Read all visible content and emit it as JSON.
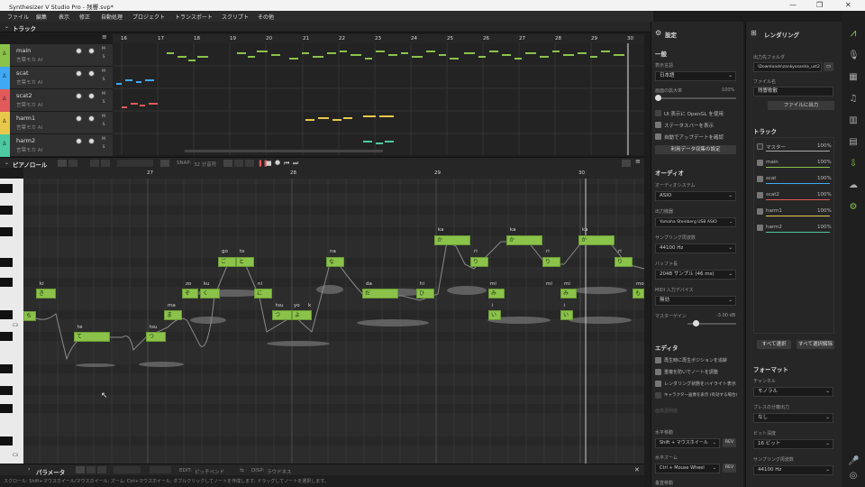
{
  "window": {
    "title": "Synthesizer V Studio Pro - 残響.svp*",
    "min": "—",
    "max": "❐",
    "close": "✕"
  },
  "menu": [
    "ファイル",
    "編集",
    "表示",
    "修正",
    "自動処理",
    "プロジェクト",
    "トランスポート",
    "スクリプト",
    "その他"
  ],
  "tracks_header": {
    "title": "トラック",
    "menu_icon": "hamburger-icon"
  },
  "tracks": [
    {
      "name": "main",
      "voice": "言葉モカ AI",
      "color": "#8bc34a"
    },
    {
      "name": "scat",
      "voice": "言葉モカ AI",
      "color": "#3fa9f5"
    },
    {
      "name": "scat2",
      "voice": "言葉モカ AI",
      "color": "#e25a5a"
    },
    {
      "name": "harm1",
      "voice": "言葉モカ AI",
      "color": "#e8c84a"
    },
    {
      "name": "harm2",
      "voice": "言葉モカ AI",
      "color": "#4cc9a0"
    }
  ],
  "track_ms": {
    "m": "M",
    "s": "S"
  },
  "arrangement_ruler": [
    "16",
    "17",
    "18",
    "19",
    "20",
    "21",
    "22",
    "23",
    "24",
    "25",
    "26",
    "27",
    "28",
    "29",
    "30"
  ],
  "pianoroll": {
    "title": "ピアノロール",
    "snap_label": "SNAP:",
    "snap_value": "32 分音符",
    "ruler": [
      "27",
      "28",
      "29",
      "30"
    ],
    "c_label": "C3",
    "c_label2": "C3",
    "notes": [
      {
        "l": "ki",
        "t": "き"
      },
      {
        "l": "",
        "t": "ち"
      },
      {
        "l": "te",
        "t": "て"
      },
      {
        "l": "tsu",
        "t": "つ"
      },
      {
        "l": "ma",
        "t": "ま"
      },
      {
        "l": "zo",
        "t": "ぞ"
      },
      {
        "l": "ku",
        "t": "く"
      },
      {
        "l": "go",
        "t": "ご"
      },
      {
        "l": "to",
        "t": "と"
      },
      {
        "l": "ni",
        "t": "に"
      },
      {
        "l": "tsu",
        "t": "つ"
      },
      {
        "l": "yo",
        "t": "よ"
      },
      {
        "l": "k",
        "t": "く"
      },
      {
        "l": "na",
        "t": "な"
      },
      {
        "l": "da",
        "t": "だ"
      },
      {
        "l": "hi",
        "t": "ひ"
      },
      {
        "l": "ka",
        "t": "か"
      },
      {
        "l": "ri",
        "t": "り"
      },
      {
        "l": "mi",
        "t": "み"
      },
      {
        "l": "ka",
        "t": "か"
      },
      {
        "l": "ri",
        "t": "り"
      },
      {
        "l": "mi",
        "t": "み"
      },
      {
        "l": "ka",
        "t": "か"
      },
      {
        "l": "ri",
        "t": "り"
      },
      {
        "l": "mo",
        "t": "も"
      },
      {
        "l": "mi",
        "t": "み"
      },
      {
        "l": "i",
        "t": "い"
      },
      {
        "l": "i",
        "t": "い"
      }
    ]
  },
  "param_bar": {
    "title": "パラメータ",
    "edit_label": "EDIT:",
    "edit_value": "ピッチベンド",
    "disp_label": "DISP:",
    "disp_value": "ラウドネス"
  },
  "status": "スクロール: Shift+マウスホイール/マウスホイール; ズーム: Ctrl+マウスホイール; ダブルクリックしてノートを作成します; ドラッグしてノートを選択します。",
  "settings": {
    "title": "設定",
    "general": "一般",
    "lang_label": "表示言語",
    "lang_value": "日本語",
    "scale_label": "画面の拡大率",
    "scale_value": "100%",
    "checks": [
      {
        "text": "UI 表示に OpenGL を使用",
        "on": false
      },
      {
        "text": "ステータスバーを表示",
        "on": true
      },
      {
        "text": "自動でアップデートを確認",
        "on": true
      }
    ],
    "data_btn": "利用データ収集の設定",
    "audio": "オーディオ",
    "sys_label": "オーディオシステム",
    "sys_value": "ASIO",
    "dev_label": "出力機器",
    "dev_value": "Yamaha Steinberg USB ASIO",
    "sr_label": "サンプリング周波数",
    "sr_value": "44100 Hz",
    "buf_label": "バッファ長",
    "buf_value": "2048 サンプル (46 ms)",
    "midi_label": "MIDI 入力デバイス",
    "midi_value": "無効",
    "gain_label": "マスターゲイン",
    "gain_value": "-3.00 dB",
    "editor": "エディタ",
    "echecks": [
      {
        "text": "再生時に再生ポジションを追跡",
        "on": true
      },
      {
        "text": "重複を防いでノートを調整",
        "on": true
      },
      {
        "text": "レンダリング状態をハイライト表示",
        "on": true
      },
      {
        "text": "キャラクター画像を表示 (有効する場合)",
        "on": false
      }
    ],
    "transparency": "画像透明度",
    "hmove_label": "水平移動",
    "hmove_value": "Shift + マウスホイール",
    "rev1": "REV",
    "hzoom_label": "水平ズーム",
    "hzoom_value": "Ctrl + Mouse Wheel",
    "rev2": "REV",
    "vmove_label": "垂直移動"
  },
  "render": {
    "title": "レンダリング",
    "folder_label": "出力先フォルダ",
    "folder_value": "\\Downloads\\zankyosanka_ust2",
    "file_label": "ファイル名",
    "file_value": "残響歌散",
    "export_btn": "ファイルに出力",
    "tracks_title": "トラック",
    "tracks": [
      {
        "name": "マスター",
        "vol": "100%",
        "on": false,
        "color": "#aaaaaa"
      },
      {
        "name": "main",
        "vol": "100%",
        "on": true,
        "color": "#8bc34a"
      },
      {
        "name": "scat",
        "vol": "100%",
        "on": true,
        "color": "#3fa9f5"
      },
      {
        "name": "scat2",
        "vol": "100%",
        "on": true,
        "color": "#e25a5a"
      },
      {
        "name": "harm1",
        "vol": "100%",
        "on": true,
        "color": "#e8c84a"
      },
      {
        "name": "harm2",
        "vol": "100%",
        "on": true,
        "color": "#4cc9a0"
      }
    ],
    "select_all": "すべて選択",
    "deselect_all": "すべて選択解除",
    "format": "フォーマット",
    "ch_label": "チャンネル",
    "ch_value": "モノラル",
    "breath_label": "ブレスの分離出力",
    "breath_value": "なし",
    "bit_label": "ビット深度",
    "bit_value": "16 ビット",
    "rsr_label": "サンプリング周波数",
    "rsr_value": "44100 Hz"
  },
  "accent": "#8bc34a"
}
